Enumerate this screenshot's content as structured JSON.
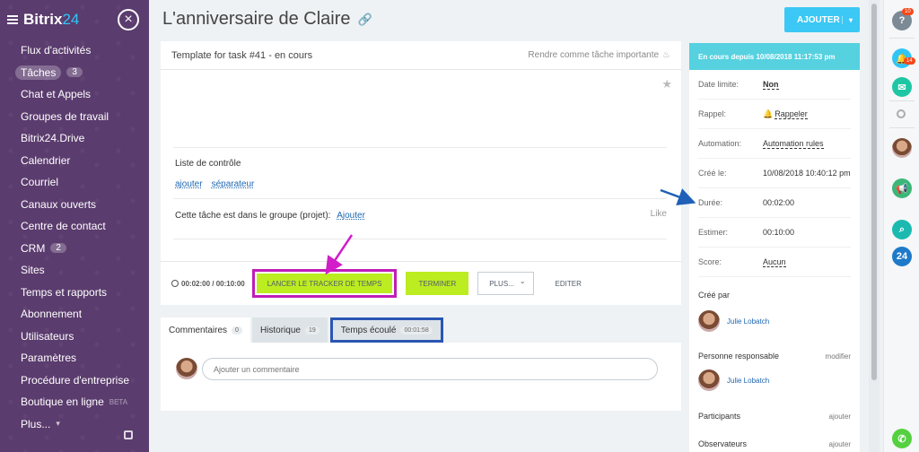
{
  "sidebar": {
    "logo_prefix": "Bitrix",
    "logo_number": "24",
    "items": [
      {
        "label": "Flux d'activités"
      },
      {
        "label": "Tâches",
        "count": "3"
      },
      {
        "label": "Chat et Appels"
      },
      {
        "label": "Groupes de travail"
      },
      {
        "label": "Bitrix24.Drive"
      },
      {
        "label": "Calendrier"
      },
      {
        "label": "Courriel"
      },
      {
        "label": "Canaux ouverts"
      },
      {
        "label": "Centre de contact"
      },
      {
        "label": "CRM",
        "count": "2"
      },
      {
        "label": "Sites"
      },
      {
        "label": "Temps et rapports"
      },
      {
        "label": "Abonnement"
      },
      {
        "label": "Utilisateurs"
      },
      {
        "label": "Paramètres"
      },
      {
        "label": "Procédure d'entreprise"
      },
      {
        "label": "Boutique en ligne",
        "beta": "BETA"
      },
      {
        "label": "Plus...",
        "caret": "▾"
      }
    ]
  },
  "header": {
    "title": "L'anniversaire de Claire",
    "add_label": "AJOUTER",
    "add_caret": "▾"
  },
  "task": {
    "title": "Template for task #41 - en cours",
    "important_label": "Rendre comme tâche importante",
    "checklist_title": "Liste de contrôle",
    "checklist_add": "ajouter",
    "checklist_separator": "séparateur",
    "group_text": "Cette tâche est dans le groupe (projet):",
    "group_add": "Ajouter",
    "like_label": "Like",
    "timer": "00:02:00 / 00:10:00",
    "tracker_button": "LANCER LE TRACKER DE TEMPS",
    "finish_button": "TERMINER",
    "more_button": "PLUS...",
    "more_caret": "⌄",
    "edit_button": "EDITER"
  },
  "tabs": [
    {
      "label": "Commentaires",
      "count": "0"
    },
    {
      "label": "Historique",
      "count": "19"
    },
    {
      "label": "Temps écoulé",
      "count": "00:01:58"
    }
  ],
  "comment": {
    "placeholder": "Ajouter un commentaire"
  },
  "info": {
    "status": "En cours depuis 10/08/2018 11:17:53 pm",
    "rows": [
      {
        "key": "Date limite:",
        "value": "Non"
      },
      {
        "key": "Rappel:",
        "value": "Rappeler"
      },
      {
        "key": "Automation:",
        "value": "Automation rules"
      },
      {
        "key": "Créé le:",
        "value": "10/08/2018 10:40:12 pm"
      },
      {
        "key": "Durée:",
        "value": "00:02:00"
      },
      {
        "key": "Estimer:",
        "value": "00:10:00"
      },
      {
        "key": "Score:",
        "value": "Aucun"
      }
    ],
    "created_by_title": "Créé par",
    "created_by_name": "Julie Lobatch",
    "responsible_title": "Personne responsable",
    "responsible_action": "modifier",
    "responsible_name": "Julie Lobatch",
    "participants_title": "Participants",
    "participants_action": "ajouter",
    "observers_title": "Observateurs",
    "observers_action": "ajouter"
  },
  "rail": {
    "help_badge": "10",
    "notif_badge": "14",
    "help_glyph": "?",
    "b24_label": "24"
  },
  "colors": {
    "sidebar_bg": "#5b3c6e",
    "accent_blue": "#3bc8f5",
    "green_button": "#bbed21",
    "highlight_magenta": "#c11cb8",
    "highlight_blue": "#2a56b3",
    "status_bar": "#56d1e0"
  }
}
